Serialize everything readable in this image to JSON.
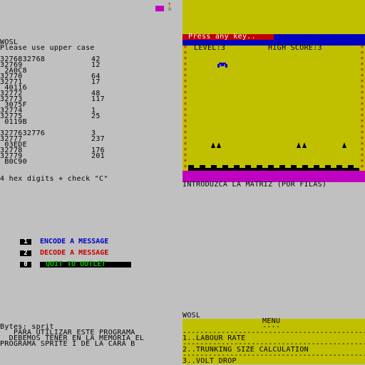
{
  "colors": {
    "yellow": "#c0c000",
    "blue": "#0000c0",
    "red": "#c00000",
    "magenta": "#c000c0",
    "green": "#00c000",
    "grey": "#c0c0c0",
    "black": "#000000",
    "white": "#ffffff"
  },
  "monitor": {
    "title": "WOSL",
    "instruction": "Please use upper case",
    "rows": [
      {
        "a": "3276832768",
        "b": "42"
      },
      {
        "a": "32769",
        "b": "12"
      },
      {
        "a": " 2A0C8",
        "b": ""
      },
      {
        "a": "32770",
        "b": "64"
      },
      {
        "a": "32771",
        "b": "17"
      },
      {
        "a": " 40116",
        "b": ""
      },
      {
        "a": "32772",
        "b": "48"
      },
      {
        "a": "32773",
        "b": "117"
      },
      {
        "a": " 3075F",
        "b": ""
      },
      {
        "a": "32774",
        "b": "1"
      },
      {
        "a": "32775",
        "b": "25"
      },
      {
        "a": " 0119B",
        "b": ""
      },
      {
        "a": "",
        "b": ""
      },
      {
        "a": "3277632776",
        "b": "3"
      },
      {
        "a": "32777",
        "b": "237"
      },
      {
        "a": " 03EDE",
        "b": ""
      },
      {
        "a": "32778",
        "b": "176"
      },
      {
        "a": "32779",
        "b": "201"
      },
      {
        "a": " B0C90",
        "b": ""
      }
    ],
    "hint": "4 hex digits + check \"C\""
  },
  "game": {
    "prompt": "Press any key..",
    "level": "LEVEL:3",
    "high_score": "HIGH SCORE:3",
    "footer": "INTRODUZCA LA MATRIZ (POR FILAS)"
  },
  "options": [
    {
      "key": "1",
      "label": "ENCODE A MESSAGE"
    },
    {
      "key": "2",
      "label": "DECODE A MESSAGE"
    },
    {
      "key": "0",
      "label": "QUIT TO OUTLET"
    }
  ],
  "loader": {
    "bytes": "Bytes: sprit",
    "line1": "   PARA UTILIZAR ESTE PROGRAMA",
    "line2": "  DEBEMOS TENER EN LA MEMORIA EL",
    "line3": "PROGRAMA SPRITE I DE LA CARA B"
  },
  "menu": {
    "app": "WOSL",
    "title": "MENU",
    "underline": "----",
    "items": [
      "1..LABOUR RATE",
      "2..TRUNKING SIZE CALCULATION",
      "3..VOLT DROP"
    ]
  }
}
